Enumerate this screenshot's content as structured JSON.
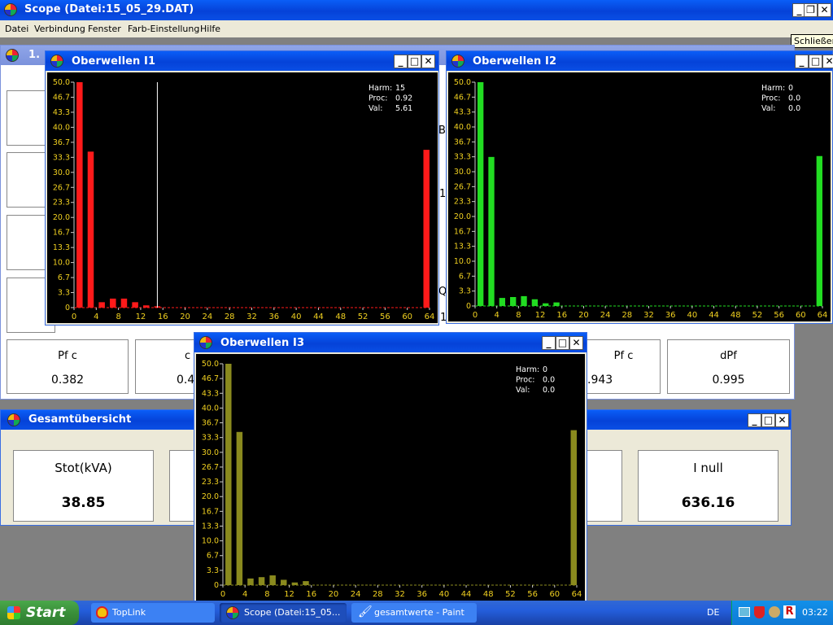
{
  "main_window": {
    "title": "Scope  (Datei:15_05_29.DAT)"
  },
  "menu": [
    "Datei",
    "Verbindung",
    "Fenster",
    "Farb-Einstellung",
    "Hilfe"
  ],
  "tooltip": "Schließen",
  "background_window": {
    "title_partial": "1.",
    "cards_row": [
      {
        "label": "Pf  c",
        "value": "0.382"
      },
      {
        "label": "c",
        "value": "0.4"
      },
      {
        "label": "Pf  c",
        "value": ".943"
      },
      {
        "label": "dPf",
        "value": "0.995"
      }
    ],
    "edge_glyphs": [
      "B",
      "1",
      "Q",
      "1"
    ]
  },
  "gesamt_window": {
    "title": "Gesamtübersicht",
    "cards": [
      {
        "label": "Stot(kVA)",
        "value": "38.85"
      },
      {
        "label": "I null",
        "value": "636.16"
      }
    ]
  },
  "chart_data": [
    {
      "type": "bar",
      "title": "Oberwellen  I1",
      "color": "#ff1a1a",
      "x": [
        1,
        3,
        5,
        7,
        9,
        11,
        13,
        15,
        64
      ],
      "values": [
        50.0,
        34.6,
        1.2,
        2.0,
        2.0,
        1.2,
        0.5,
        0.3,
        35.0
      ],
      "ylim": [
        0,
        50
      ],
      "yticks": [
        "0",
        "3.3",
        "6.7",
        "10.0",
        "13.3",
        "16.7",
        "20.0",
        "23.3",
        "26.7",
        "30.0",
        "33.3",
        "36.7",
        "40.0",
        "43.3",
        "46.7",
        "50.0"
      ],
      "xticks": [
        "0",
        "4",
        "8",
        "12",
        "16",
        "20",
        "24",
        "28",
        "32",
        "36",
        "40",
        "44",
        "48",
        "52",
        "56",
        "60",
        "64"
      ],
      "cursor_x": 15,
      "info": {
        "harm_label": "Harm:",
        "harm": "15",
        "proc_label": "Proc:",
        "proc": "0.92",
        "val_label": "Val:",
        "val": "5.61"
      }
    },
    {
      "type": "bar",
      "title": "Oberwellen  I2",
      "color": "#22dd22",
      "x": [
        1,
        3,
        5,
        7,
        9,
        11,
        13,
        15,
        64
      ],
      "values": [
        50.0,
        33.3,
        1.8,
        2.0,
        2.2,
        1.5,
        0.6,
        0.8,
        33.5
      ],
      "ylim": [
        0,
        50
      ],
      "yticks": [
        "0",
        "3.3",
        "6.7",
        "10.0",
        "13.3",
        "16.7",
        "20.0",
        "23.3",
        "26.7",
        "30.0",
        "33.3",
        "36.7",
        "40.0",
        "43.3",
        "46.7",
        "50.0"
      ],
      "xticks": [
        "0",
        "4",
        "8",
        "12",
        "16",
        "20",
        "24",
        "28",
        "32",
        "36",
        "40",
        "44",
        "48",
        "52",
        "56",
        "60",
        "64"
      ],
      "info": {
        "harm_label": "Harm:",
        "harm": "0",
        "proc_label": "Proc:",
        "proc": "0.0",
        "val_label": "Val:",
        "val": "0.0"
      }
    },
    {
      "type": "bar",
      "title": "Oberwellen  I3",
      "color": "#8a8a1e",
      "x": [
        1,
        3,
        5,
        7,
        9,
        11,
        13,
        15,
        64
      ],
      "values": [
        50.0,
        34.6,
        1.5,
        1.8,
        2.2,
        1.2,
        0.6,
        0.9,
        35.0
      ],
      "ylim": [
        0,
        50
      ],
      "yticks": [
        "0",
        "3.3",
        "6.7",
        "10.0",
        "13.3",
        "16.7",
        "20.0",
        "23.3",
        "26.7",
        "30.0",
        "33.3",
        "36.7",
        "40.0",
        "43.3",
        "46.7",
        "50.0"
      ],
      "xticks": [
        "0",
        "4",
        "8",
        "12",
        "16",
        "20",
        "24",
        "28",
        "32",
        "36",
        "40",
        "44",
        "48",
        "52",
        "56",
        "60",
        "64"
      ],
      "info": {
        "harm_label": "Harm:",
        "harm": "0",
        "proc_label": "Proc:",
        "proc": "0.0",
        "val_label": "Val:",
        "val": "0.0"
      }
    }
  ],
  "taskbar": {
    "start": "Start",
    "tasks": [
      "TopLink",
      "Scope  (Datei:15_05...",
      "gesamtwerte - Paint"
    ],
    "lang": "DE",
    "clock": "03:22"
  }
}
